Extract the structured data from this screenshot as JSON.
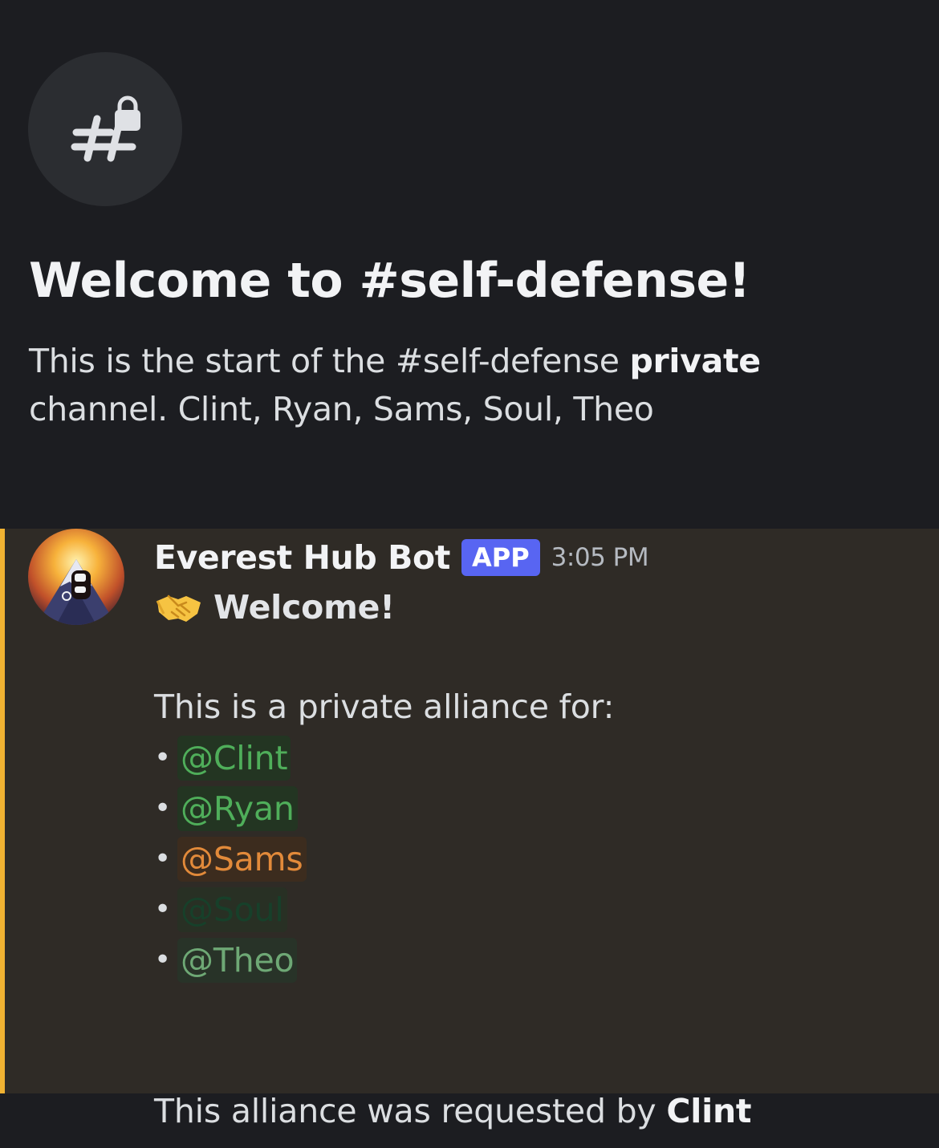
{
  "channel": {
    "icon": "locked-hashtag-icon",
    "welcome_title": "Welcome to #self-defense!",
    "desc_prefix": "This is the start of the #self-defense ",
    "desc_strong": "private",
    "desc_suffix": " channel. Clint, Ryan, Sams, Soul, Theo"
  },
  "message": {
    "accent_color": "#f0b232",
    "author": "Everest Hub Bot",
    "badge": "APP",
    "timestamp": "3:05 PM",
    "emoji": "handshake",
    "welcome_text": "Welcome!",
    "intro": "This is a private alliance for:",
    "bullet": "•",
    "mentions": [
      {
        "label": "@Clint",
        "color": "#4fae5a",
        "bg": "#233522"
      },
      {
        "label": "@Ryan",
        "color": "#4fae5a",
        "bg": "#233522"
      },
      {
        "label": "@Sams",
        "color": "#e28a3a",
        "bg": "#3c2c1e"
      },
      {
        "label": "@Soul",
        "color": "#17402a",
        "bg": "#283024"
      },
      {
        "label": "@Theo",
        "color": "#6ea875",
        "bg": "#283328"
      }
    ],
    "requested_prefix": "This alliance was requested by ",
    "requested_by": "Clint"
  }
}
